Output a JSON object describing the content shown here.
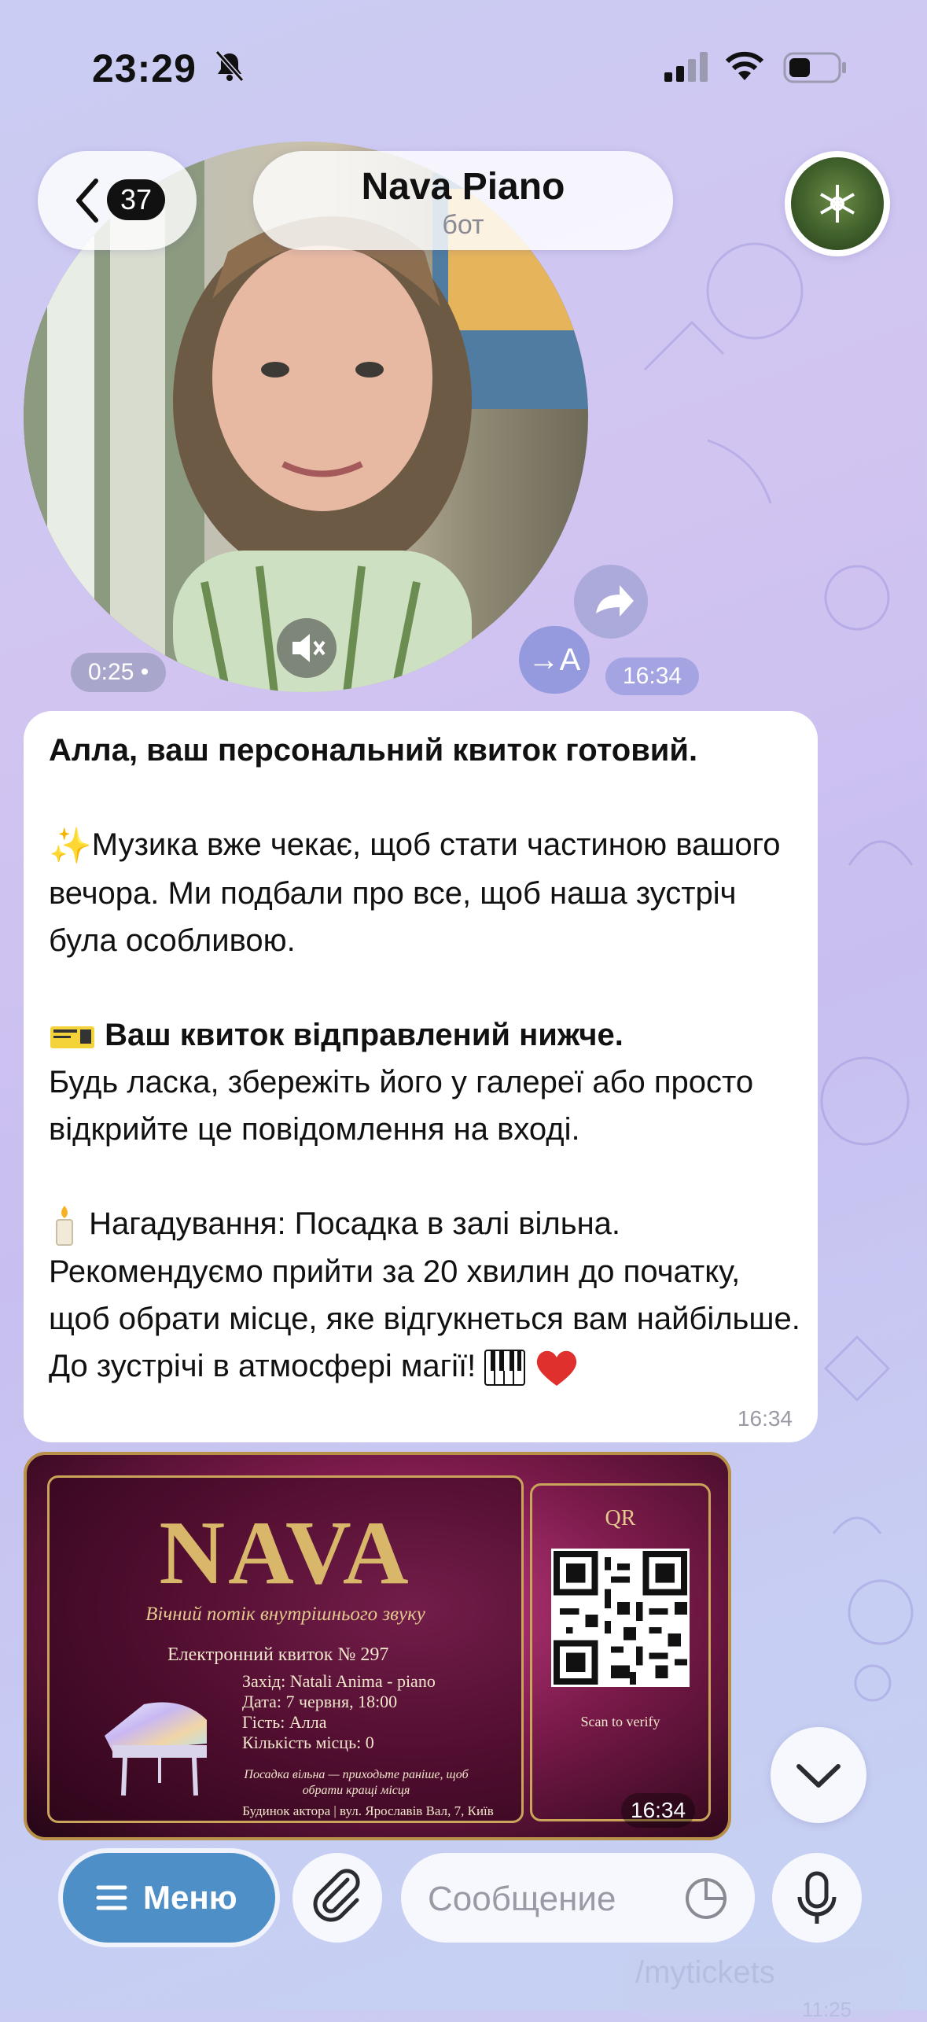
{
  "status_bar": {
    "time": "23:29"
  },
  "header": {
    "back_count": "37",
    "chat_name": "Nava Piano",
    "chat_subtitle": "бот"
  },
  "video_message": {
    "duration": "0:25 •",
    "time": "16:34",
    "translate_label": "→A"
  },
  "message": {
    "lines": [
      "Алла, ваш персональний квиток готовий.",
      "Музика вже чекає, щоб стати частиною вашого вечора. Ми подбали про все, щоб наша зустріч була особливою.",
      "Ваш квиток відправлений нижче.",
      "Будь ласка, збережіть його у галереї або просто відкрийте це повідомлення на вході.",
      "Нагадування: Посадка в залі вільна.",
      "Рекомендуємо прийти за 20 хвилин до початку, щоб обрати місце, яке відгукнеться вам найбільше.",
      "До зустрічі в атмосфері магії!"
    ],
    "time": "16:34"
  },
  "ticket": {
    "title": "NAVA",
    "subtitle": "Вічний потік внутрішнього звуку",
    "number_line": "Електронний квиток № 297",
    "event": "Захід: Natali Anima - piano",
    "date": "Дата: 7 червня, 18:00",
    "guest": "Гість: Алла",
    "seats": "Кількість місць: 0",
    "note": "Посадка вільна — приходьте раніше, щоб обрати кращі місця",
    "address": "Будинок актора | вул. Ярославів Вал, 7, Київ",
    "qr_label": "QR",
    "scan_label": "Scan to verify",
    "time": "16:34"
  },
  "composer": {
    "menu_label": "Меню",
    "placeholder": "Сообщение"
  },
  "previous_message": {
    "text": "/mytickets",
    "time": "11:25"
  }
}
